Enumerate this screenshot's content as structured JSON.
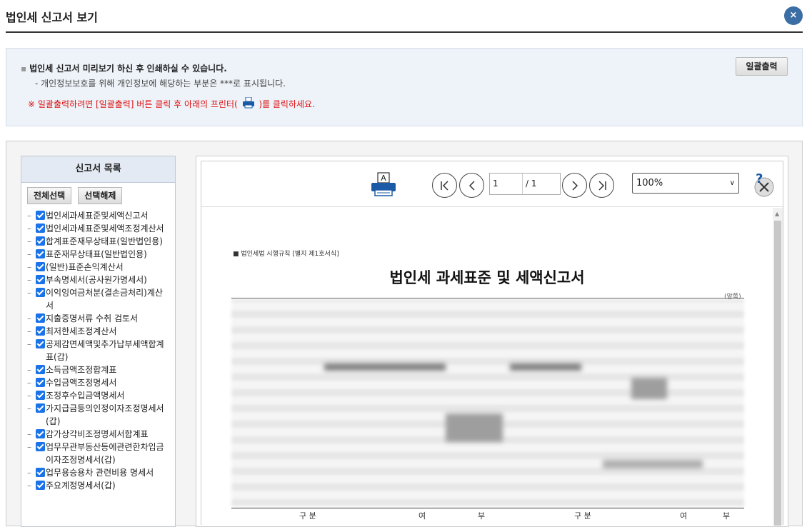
{
  "header": {
    "title": "법인세 신고서 보기",
    "close_icon": "×"
  },
  "notice": {
    "line1": "법인세 신고서 미리보기 하신 후 인쇄하실 수 있습니다.",
    "line2": "- 개인정보보호를 위해 개인정보에 해당하는 부분은  ***로 표시됩니다.",
    "line3_before": "※ 일괄출력하려면 [일괄출력] 버튼 클릭 후 아래의 프린터(",
    "line3_after": ")를 클릭하세요.",
    "batch_print_label": "일괄출력"
  },
  "sidebar": {
    "title": "신고서 목록",
    "select_all": "전체선택",
    "deselect": "선택해제",
    "items": [
      "법인세과세표준및세액신고서",
      "법인세과세표준및세액조정계산서",
      "합계표준재무상태표(일반법인용)",
      "표준재무상태표(일반법인용)",
      "(일반)표준손익계산서",
      "부속명세서(공사원가명세서)",
      "이익잉여금처분(결손금처리)계산서",
      "지출증명서류 수취 검토서",
      "최저한세조정계산서",
      "공제감면세액및추가납부세액합계표(갑)",
      "소득금액조정합계표",
      "수입금액조정명세서",
      "조정후수입금액명세서",
      "가지급금등의인정이자조정명세서(갑)",
      "감가상각비조정명세서합계표",
      "업무무관부동산등에관련한차입금이자조정명세서(갑)",
      "업무용승용차 관련비용 명세서",
      "주요계정명세서(갑)"
    ]
  },
  "viewer": {
    "page_current": "1",
    "page_total": "/ 1",
    "zoom": "100%",
    "zoom_arrow": "∨",
    "help_icon": "?"
  },
  "document": {
    "form_code": "■ 법인세법 시행규칙 [별지 제1호서식]",
    "title": "법인세 과세표준 및 세액신고서",
    "side_note": "(앞쪽)",
    "bottom_cols": [
      "구 분",
      "여",
      "부",
      "구 분",
      "여",
      "부"
    ]
  },
  "colors": {
    "accent": "#3a6ea5",
    "warning": "#dd1111",
    "checkbox": "#1a73e8"
  }
}
